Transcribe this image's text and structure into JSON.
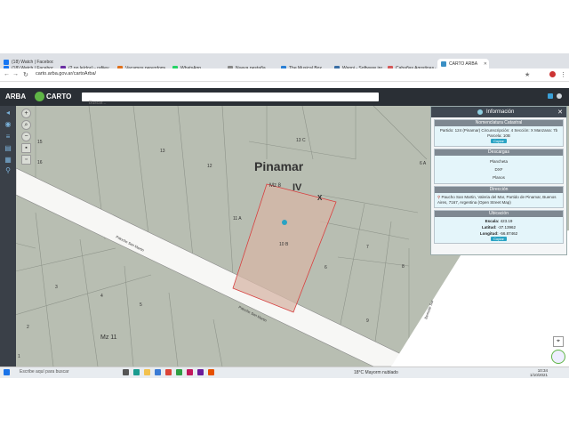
{
  "browser": {
    "tabs": [
      {
        "label": "(18) Watch | Facebook",
        "color": "#1877f2"
      },
      {
        "label": "(18) Watch | Facebook",
        "color": "#1877f2"
      },
      {
        "label": "(2 no leídos) - rafiiey",
        "color": "#6b2fa3"
      },
      {
        "label": "Vacamos perezdomo",
        "color": "#e0701b"
      },
      {
        "label": "WhatsApp",
        "color": "#25d366"
      },
      {
        "label": "Nueva pestaña",
        "color": "#888888"
      },
      {
        "label": "The Musical Box",
        "color": "#2a7fd4"
      },
      {
        "label": "Wanni - Software inmo",
        "color": "#3a6ea5"
      },
      {
        "label": "Cabañas Agostinas e",
        "color": "#d45a5a"
      },
      {
        "label": "CARTO ARBA",
        "color": "#3a8fc4"
      }
    ],
    "url": "carto.arba.gov.ar/cartoArba/"
  },
  "app": {
    "brand": "ARBA",
    "product": "CARTO",
    "search_placeholder": "Buscar..."
  },
  "map": {
    "city": "Pinamar",
    "circ": "IV",
    "x": "X",
    "mz8": "Mz 8",
    "mz11": "Mz 11",
    "street": "Paloche San Martin",
    "parcels": [
      "13 C",
      "13",
      "12",
      "11 A",
      "10 B",
      "6 A",
      "6",
      "7",
      "8",
      "9",
      "4",
      "5",
      "3",
      "2",
      "1",
      "15",
      "16"
    ],
    "side_street": "Bemotte Sur"
  },
  "panel": {
    "title": "Información",
    "sections": {
      "nomenclatura": {
        "header": "Nomenclatura Catastral",
        "text": "Partido: 124 (Pinamar) Circunscripción: 4 Sección: X Manzana: 7b Parcela: 10B",
        "button": "Copiar"
      },
      "descargas": {
        "header": "Descargas",
        "items": [
          "Plancheta",
          "DXF",
          "Planos"
        ]
      },
      "direccion": {
        "header": "Dirección",
        "text": "Paucho San Martin, Valeria del Mar, Partido de Pinamar, Buenos Aires, 7167, Argentina (Open Street Map)"
      },
      "ubicacion": {
        "header": "Ubicación",
        "escala_label": "Escala:",
        "escala": "423.19",
        "latitud_label": "Latitud:",
        "latitud": "-37.13962",
        "longitud_label": "Longitud:",
        "longitud": "-56.87462",
        "button": "Copiar"
      }
    }
  },
  "taskbar": {
    "search": "Escribe aquí para buscar",
    "weather": "18°C  Mayorm nublado",
    "time": "10:34",
    "date": "1/10/2021"
  }
}
